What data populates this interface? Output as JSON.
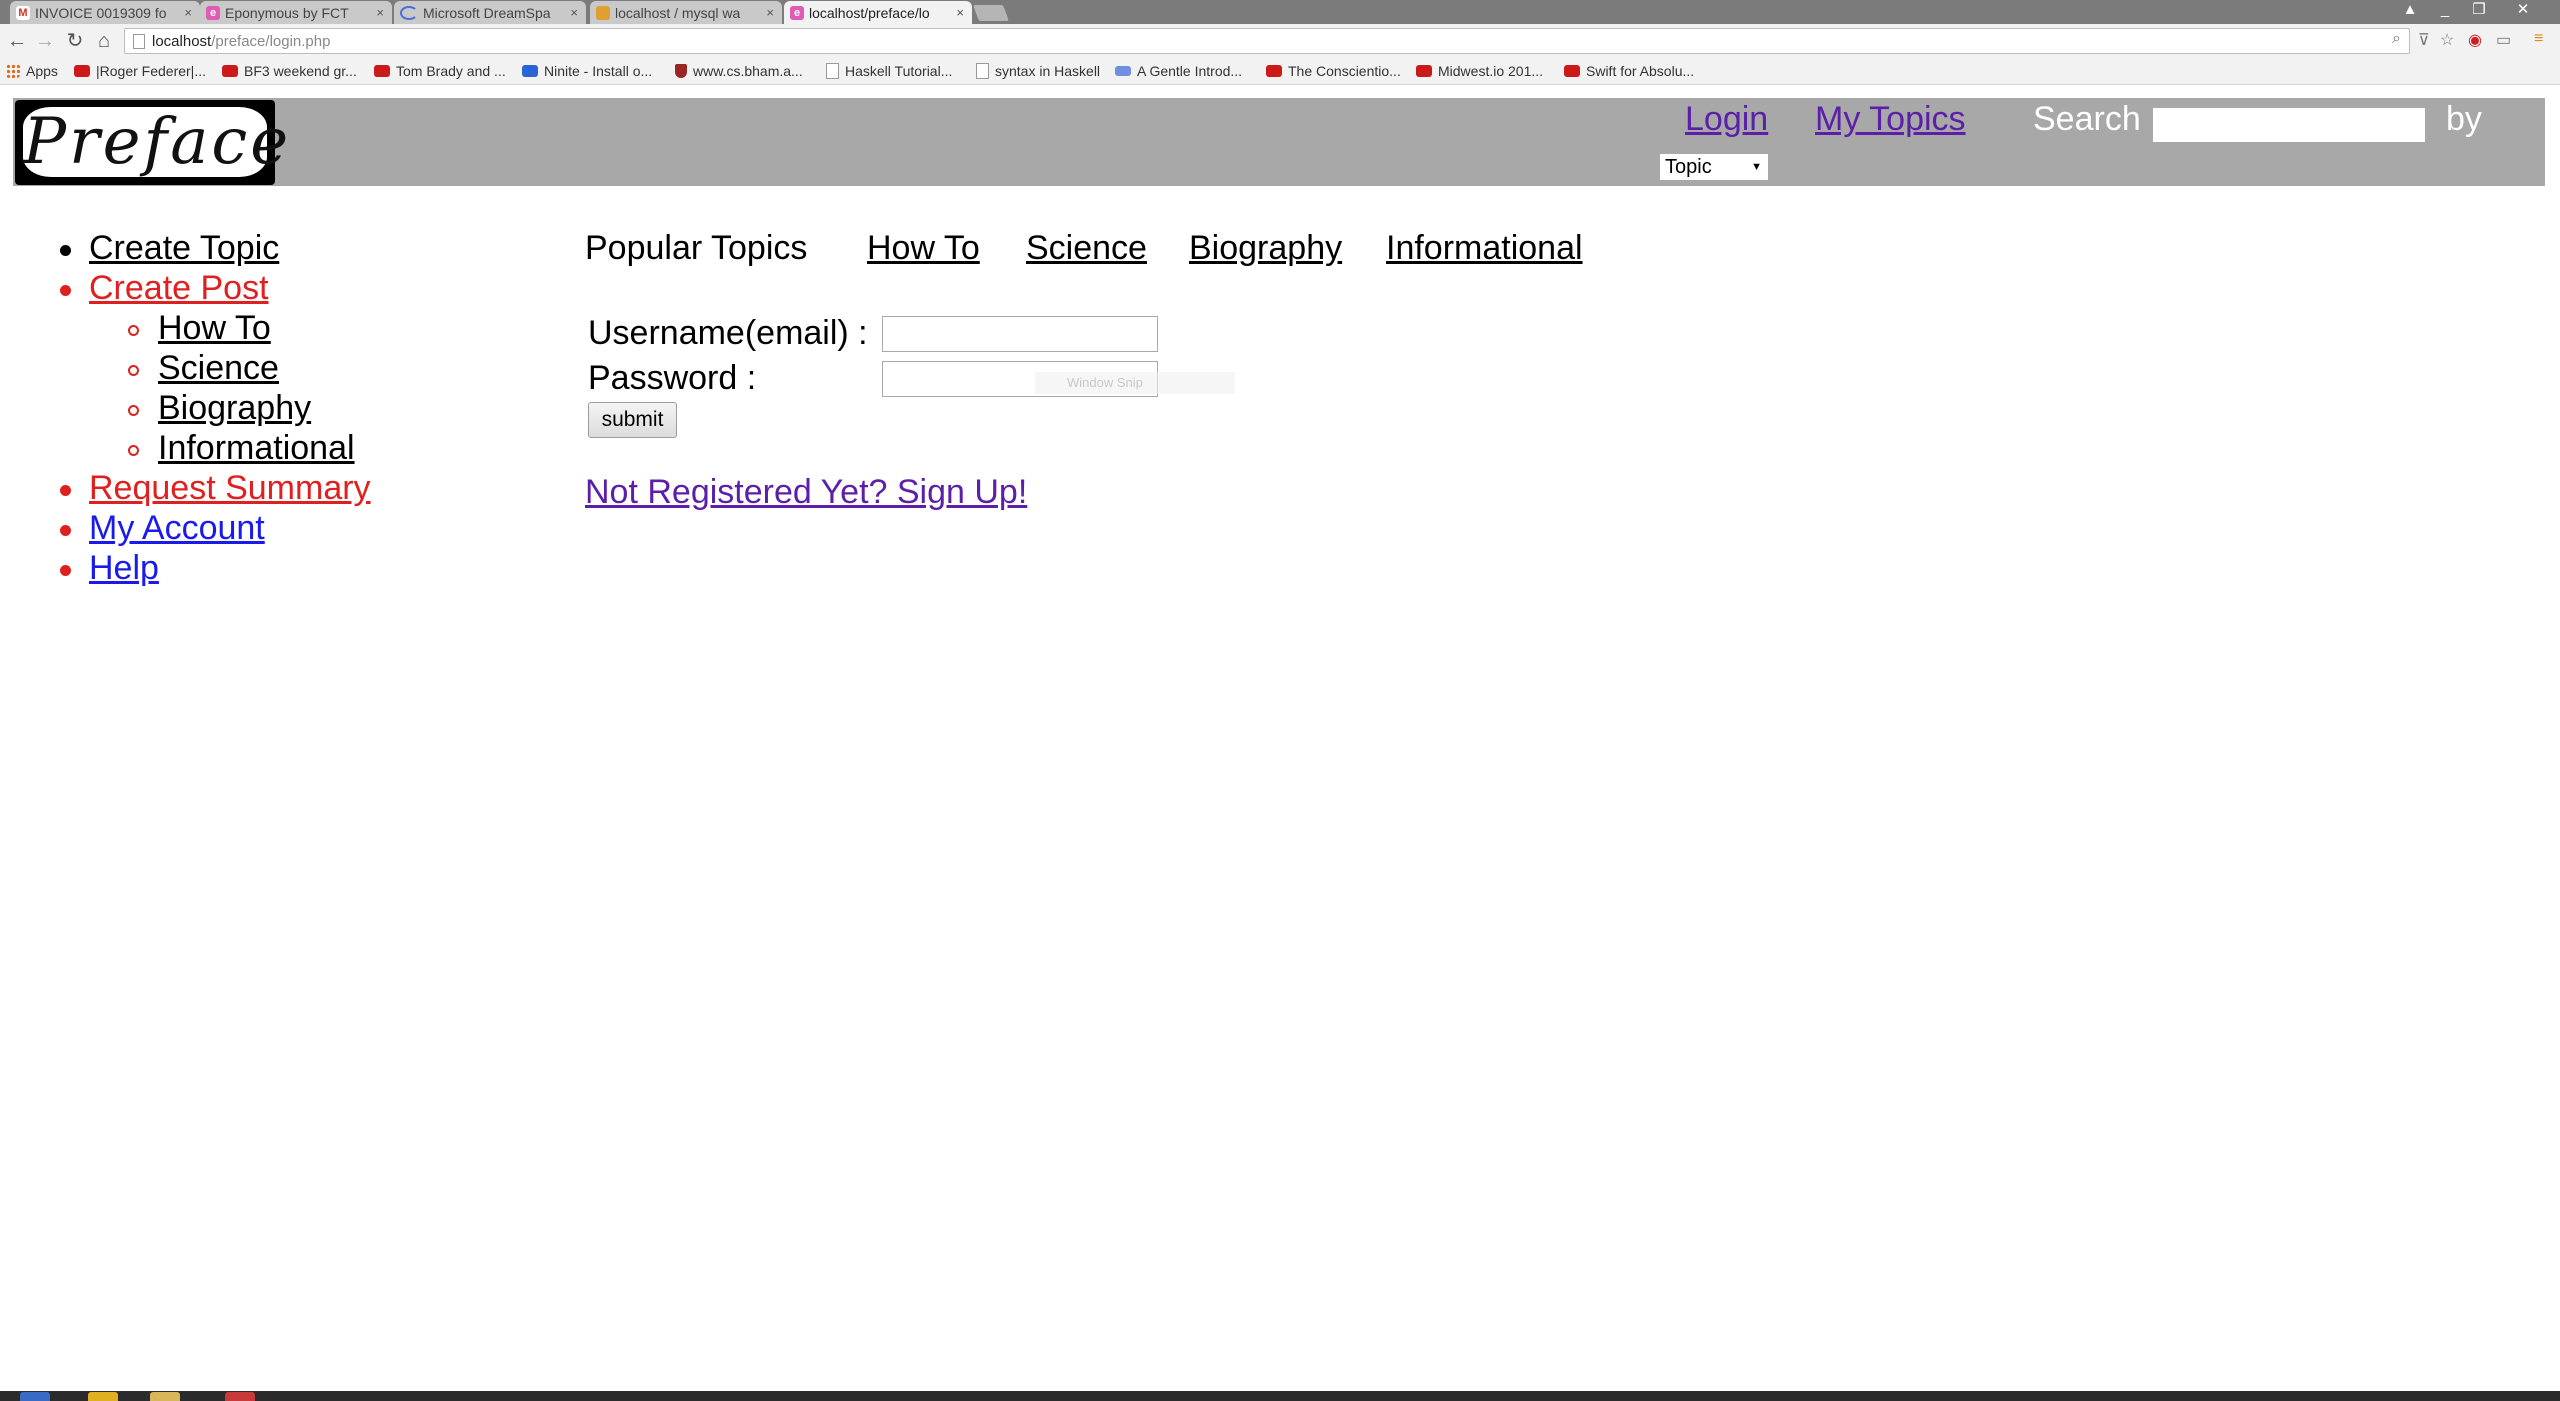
{
  "browser": {
    "tabs": [
      {
        "title": "INVOICE 0019309 fo",
        "favicon": "gmail-icon",
        "color": "#d93025",
        "glyph": "M"
      },
      {
        "title": "Eponymous by FCT",
        "favicon": "site-icon",
        "color": "#e05bb5",
        "glyph": "e"
      },
      {
        "title": "Microsoft DreamSpa",
        "favicon": "loading-icon",
        "color": "#4a6fd8",
        "glyph": ""
      },
      {
        "title": "localhost / mysql wa",
        "favicon": "phpmyadmin-icon",
        "color": "#e0a030",
        "glyph": ""
      },
      {
        "title": "localhost/preface/lo",
        "favicon": "site-icon",
        "color": "#e05bb5",
        "glyph": "e"
      }
    ],
    "url_host": "localhost",
    "url_path": "/preface/login.php",
    "bookmarks": [
      {
        "label": "Apps",
        "icon": "apps"
      },
      {
        "label": "|Roger Federer|...",
        "icon": "yt"
      },
      {
        "label": "BF3 weekend gr...",
        "icon": "yt"
      },
      {
        "label": "Tom Brady and ...",
        "icon": "yt"
      },
      {
        "label": "Ninite - Install o...",
        "icon": "nin"
      },
      {
        "label": "www.cs.bham.a...",
        "icon": "shield"
      },
      {
        "label": "Haskell Tutorial...",
        "icon": "page"
      },
      {
        "label": "syntax in Haskell",
        "icon": "page"
      },
      {
        "label": "A Gentle Introd...",
        "icon": "gent"
      },
      {
        "label": "The Conscientio...",
        "icon": "yt"
      },
      {
        "label": "Midwest.io 201...",
        "icon": "yt"
      },
      {
        "label": "Swift for Absolu...",
        "icon": "yt"
      }
    ]
  },
  "header": {
    "logo_text": "Preface",
    "login_label": " Login",
    "my_topics_label": " My Topics",
    "search_label": "Search",
    "by_label": "by",
    "search_by_selected": "Topic"
  },
  "sidebar": {
    "items": [
      {
        "label": "Create Topic"
      },
      {
        "label": "Create Post",
        "children": [
          {
            "label": "How To"
          },
          {
            "label": "Science"
          },
          {
            "label": "Biography"
          },
          {
            "label": "Informational"
          }
        ]
      },
      {
        "label": "Request Summary"
      },
      {
        "label": "My Account"
      },
      {
        "label": "Help"
      }
    ]
  },
  "popular": {
    "label": "Popular Topics",
    "links": [
      "How To",
      "Science",
      "Biography",
      "Informational"
    ]
  },
  "login": {
    "username_label": "Username(email) :",
    "password_label": "Password :",
    "username_value": "",
    "password_value": "",
    "submit_label": "submit",
    "signup_label": "Not Registered Yet? Sign Up!",
    "snip_hint": "Window Snip"
  },
  "colors": {
    "header_bg": "#a8a8a8",
    "link_visited": "#5c1fa8",
    "link_red": "#e02020",
    "link_blue": "#1a1aee"
  }
}
